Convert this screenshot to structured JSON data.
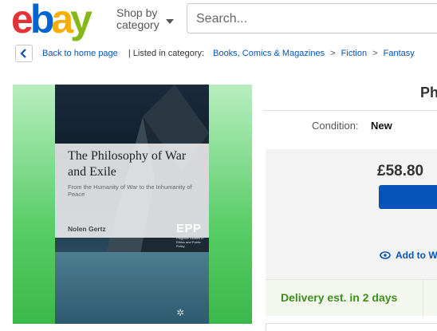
{
  "header": {
    "logo_letters": [
      "e",
      "b",
      "a",
      "y"
    ],
    "logo_colors": [
      "#e53238",
      "#0064d2",
      "#f5af02",
      "#86b817"
    ],
    "shop_by_line1": "Shop by",
    "shop_by_line2": "category",
    "search_placeholder": "Search..."
  },
  "breadcrumb": {
    "back_label": "Back to home page",
    "listed_label": "| Listed in category:",
    "items": [
      "Books, Comics & Magazines",
      "Fiction",
      "Fantasy"
    ],
    "separator": ">"
  },
  "product": {
    "title_visible": "Ph",
    "condition_label": "Condition:",
    "condition_value": "New",
    "price": "£58.80",
    "watch_label": "Add to W",
    "delivery": "Delivery est. in 2 days"
  },
  "cover": {
    "title": "The Philosophy of War and Exile",
    "subtitle": "From the Humanity of War to the Inhumanity of Peace",
    "author": "Nolen Gertz",
    "series_logo": "EPP",
    "series_sub": "Palgrave Studies in Ethics and Public Policy"
  },
  "colors": {
    "link": "#0654ba",
    "delivery_green": "#3e8e1e",
    "buy_blue": "#0654ba"
  }
}
